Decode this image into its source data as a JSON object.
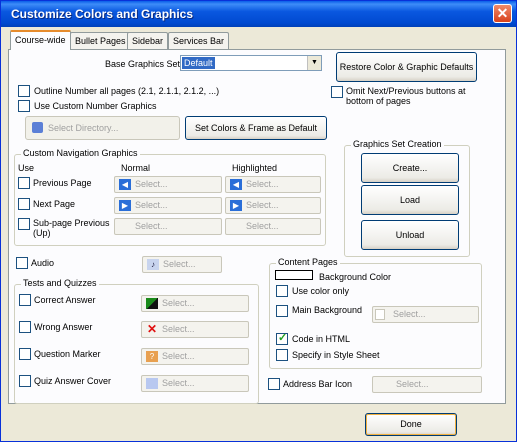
{
  "window": {
    "title": "Customize Colors and Graphics"
  },
  "tabs": [
    "Course-wide",
    "Bullet Pages",
    "Sidebar",
    "Services Bar"
  ],
  "base": {
    "label": "Base Graphics Set",
    "value": "Default",
    "restore_button": "Restore Color & Graphic Defaults"
  },
  "options": {
    "outline_numbers": "Outline Number all pages (2.1, 2.1.1, 2.1.2, ...)",
    "custom_number_graphics": "Use Custom Number Graphics",
    "omit_nav": "Omit Next/Previous buttons at bottom of pages",
    "select_directory": "Select Directory...",
    "set_colors_default": "Set Colors & Frame as Default"
  },
  "nav_graphics": {
    "title": "Custom Navigation Graphics",
    "col_use": "Use",
    "col_normal": "Normal",
    "col_highlighted": "Highlighted",
    "rows": [
      "Previous Page",
      "Next Page",
      "Sub-page Previous (Up)"
    ],
    "select_label": "Select..."
  },
  "graphics_set": {
    "title": "Graphics Set Creation",
    "create": "Create...",
    "load": "Load",
    "unload": "Unload"
  },
  "audio": {
    "label": "Audio",
    "select": "Select..."
  },
  "tests": {
    "title": "Tests and Quizzes",
    "rows": [
      "Correct Answer",
      "Wrong Answer",
      "Question Marker",
      "Quiz Answer Cover"
    ],
    "select_label": "Select..."
  },
  "content_pages": {
    "title": "Content Pages",
    "bg_color": "Background Color",
    "use_color_only": "Use color only",
    "main_background": "Main Background",
    "select_label": "Select...",
    "code_in_html": "Code in HTML",
    "specify_style": "Specify in Style Sheet",
    "code_in_html_checked": true
  },
  "address_bar": {
    "label": "Address Bar Icon",
    "select": "Select..."
  },
  "footer": {
    "done": "Done"
  }
}
